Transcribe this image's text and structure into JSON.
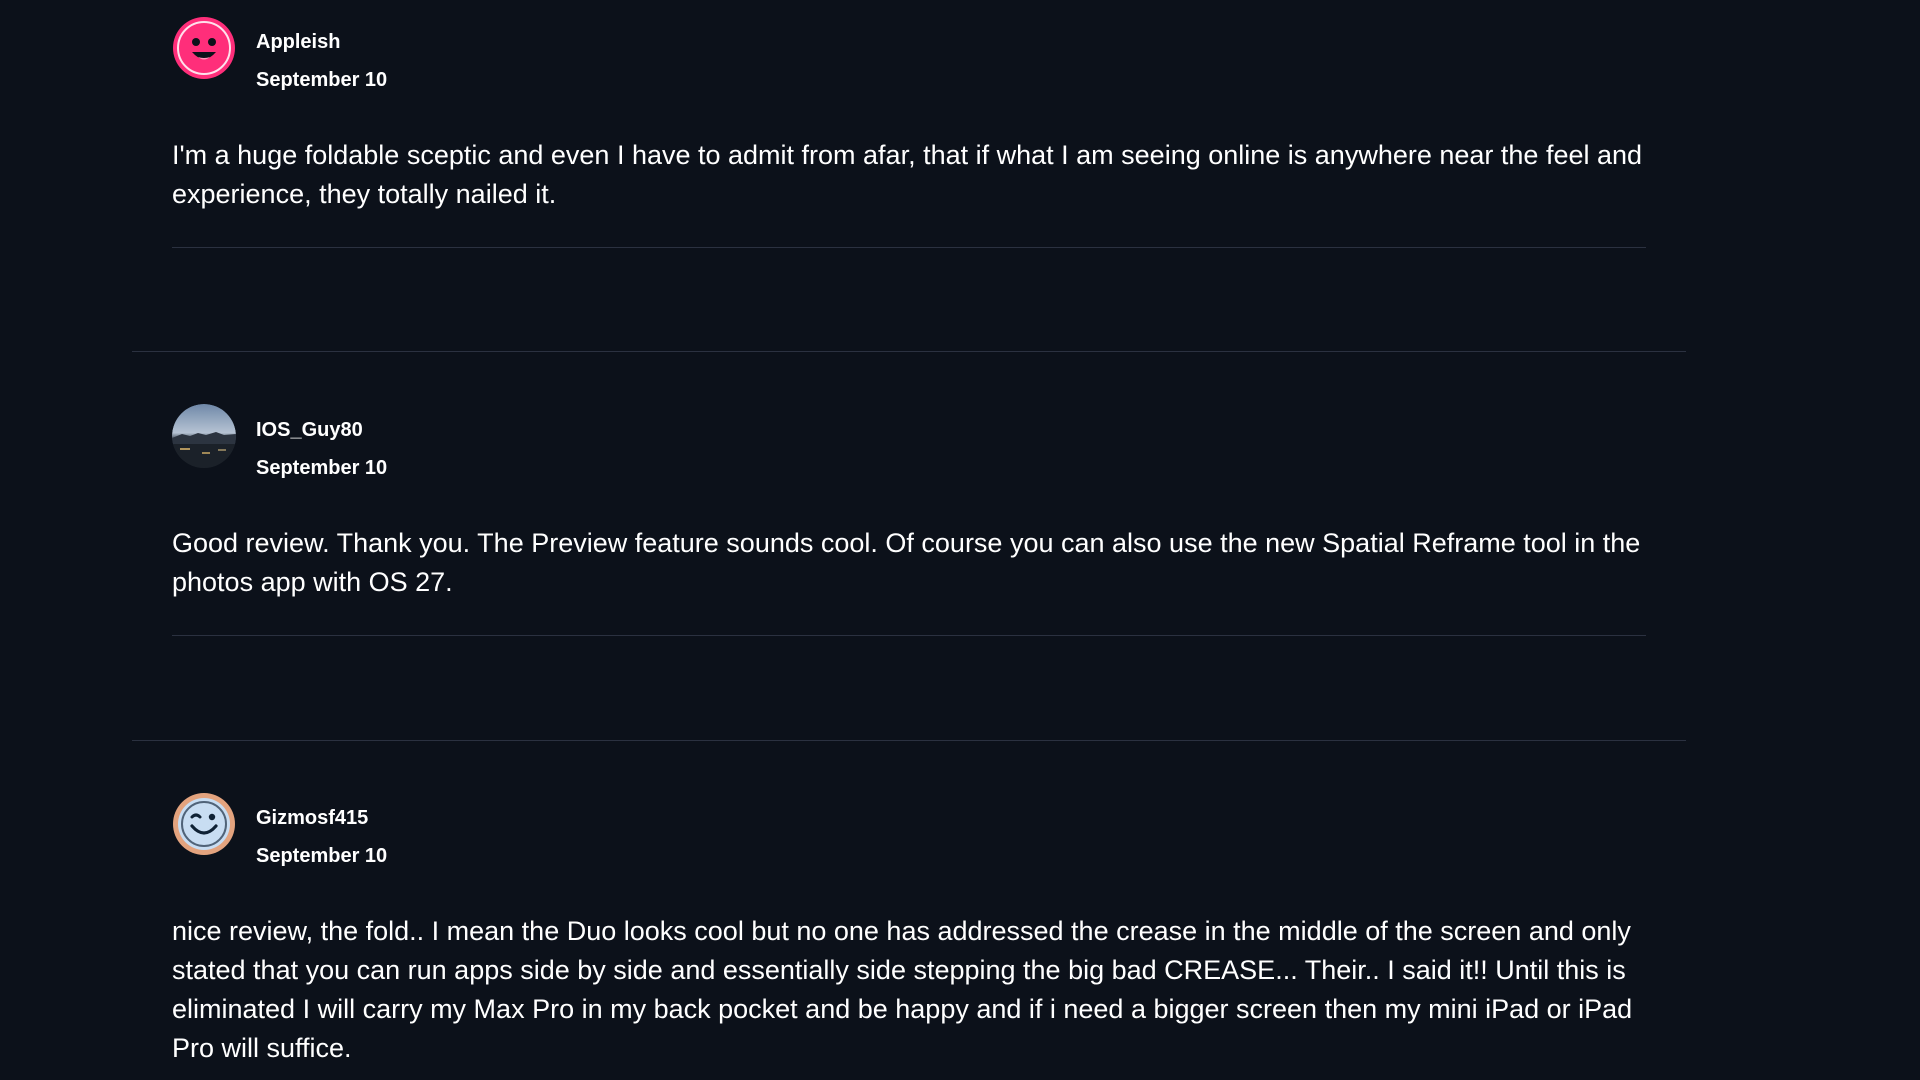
{
  "comments": [
    {
      "username": "Appleish",
      "date": "September 10",
      "body": "I'm a huge foldable sceptic and even I have to admit from afar, that if what I am seeing online is anywhere near the feel and experience, they totally nailed it.",
      "avatar_icon": "smiley-face-icon",
      "avatar_color": "#ff2e7a"
    },
    {
      "username": "IOS_Guy80",
      "date": "September 10",
      "body": "Good review. Thank you. The Preview feature sounds cool. Of course you can also use the new Spatial Reframe tool in the photos app with OS 27.",
      "avatar_icon": "landscape-photo-icon",
      "avatar_color": "#6f88a8"
    },
    {
      "username": "Gizmosf415",
      "date": "September 10",
      "body": "nice review, the fold.. I mean the Duo looks cool but no one has addressed the crease in the middle of the screen and only stated that you can run apps side by side and essentially side stepping the big bad CREASE... Their.. I said it!! Until this is eliminated I will carry my Max Pro in my back pocket and be happy and if i need a bigger screen then my mini iPad or iPad Pro will suffice.",
      "avatar_icon": "winking-face-icon",
      "avatar_color": "#e3a37e"
    }
  ]
}
